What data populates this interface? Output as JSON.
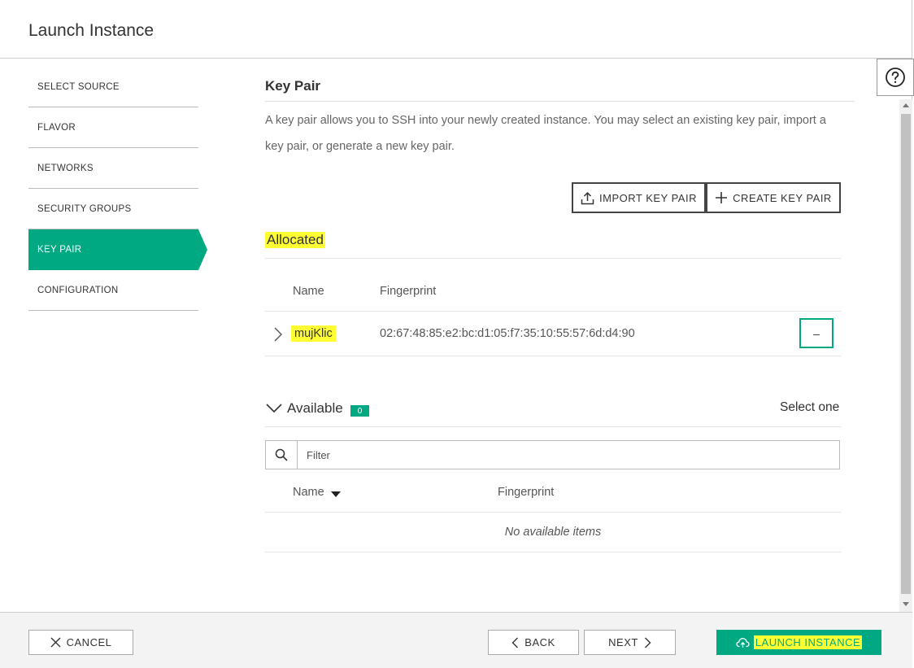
{
  "header": {
    "title": "Launch Instance"
  },
  "help": {
    "icon": "question-circle-icon"
  },
  "sidebar": {
    "items": [
      {
        "label": "SELECT SOURCE"
      },
      {
        "label": "FLAVOR"
      },
      {
        "label": "NETWORKS"
      },
      {
        "label": "SECURITY GROUPS"
      },
      {
        "label": "KEY PAIR",
        "active": true
      },
      {
        "label": "CONFIGURATION"
      }
    ]
  },
  "main": {
    "title": "Key Pair",
    "description": "A key pair allows you to SSH into your newly created instance. You may select an existing key pair, import a key pair, or generate a new key pair.",
    "import_label": "IMPORT KEY PAIR",
    "create_label": "CREATE KEY PAIR",
    "allocated": {
      "title": "Allocated",
      "columns": [
        "Name",
        "Fingerprint"
      ],
      "rows": [
        {
          "name": "mujKlic",
          "fingerprint": "02:67:48:85:e2:bc:d1:05:f7:35:10:55:57:6d:d4:90",
          "action": "–"
        }
      ]
    },
    "available": {
      "title": "Available",
      "count": "0",
      "select_hint": "Select one",
      "filter_placeholder": "Filter",
      "columns": [
        "Name",
        "Fingerprint"
      ],
      "empty_text": "No available items"
    }
  },
  "footer": {
    "cancel_label": "CANCEL",
    "back_label": "BACK",
    "next_label": "NEXT",
    "launch_label": "LAUNCH INSTANCE"
  },
  "colors": {
    "accent": "#01a982",
    "highlight": "#ffff33"
  }
}
